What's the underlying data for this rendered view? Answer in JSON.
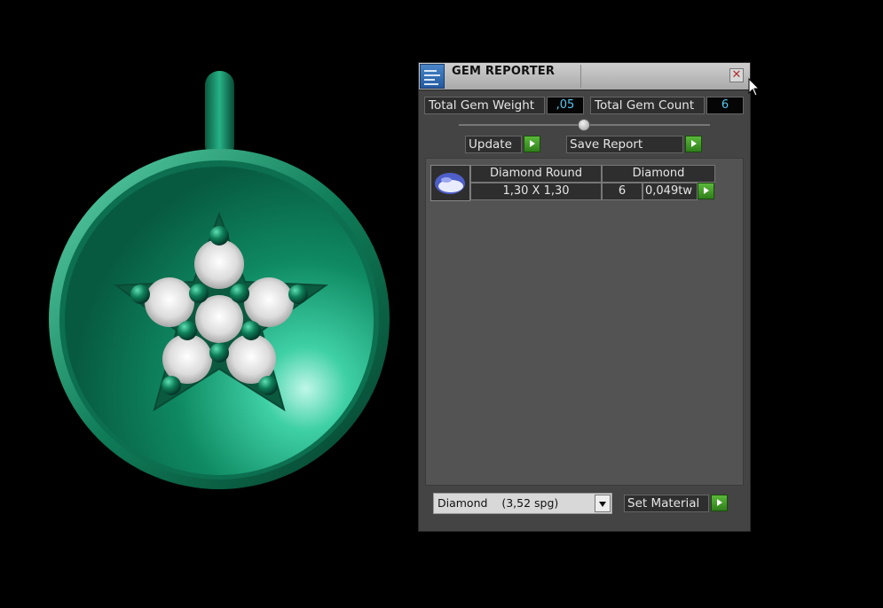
{
  "panel": {
    "title": "GEM REPORTER",
    "close_glyph": "✕",
    "total_gem_weight_label": "Total Gem Weight",
    "total_gem_weight_value": ",05",
    "total_gem_count_label": "Total Gem Count",
    "total_gem_count_value": "6",
    "update_label": "Update",
    "save_report_label": "Save Report",
    "set_material_label": "Set Material",
    "material_selected": "Diamond    (3,52 spg)"
  },
  "gems": [
    {
      "name": "Diamond Round",
      "material": "Diamond",
      "size": "1,30 X 1,30",
      "count": "6",
      "weight": "0,049tw"
    }
  ],
  "icons": {
    "app": "gem-reporter-icon",
    "close": "close-icon",
    "go": "green-play-arrow-icon",
    "dropdown": "chevron-down-icon",
    "gem": "round-gem-icon",
    "cursor": "mouse-pointer-icon"
  },
  "colors": {
    "accent_value": "#57c7f0",
    "go_button": "#3f9a24",
    "pendant": "#0f8a62",
    "panel": "#444444"
  }
}
